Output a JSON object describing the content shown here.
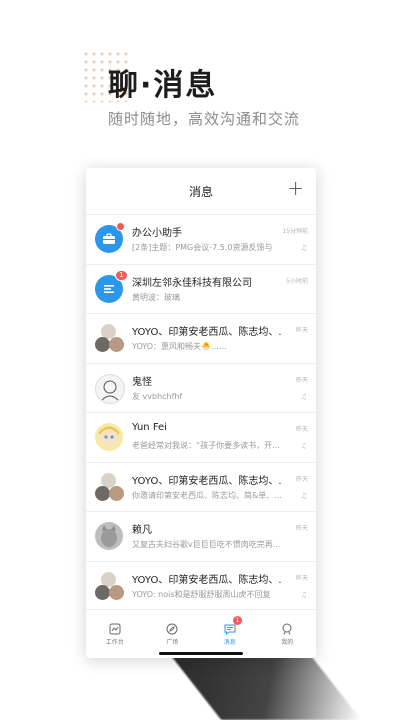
{
  "hero": {
    "title": "聊·消息",
    "subtitle": "随时随地，高效沟通和交流"
  },
  "header": {
    "title": "消息",
    "add_icon": "plus-icon"
  },
  "conversations": [
    {
      "name": "办公小助手",
      "preview": "[2条]主题：PMG会议-7.5.0资源反馈与",
      "time": "15分钟前",
      "badge": "",
      "muted": true
    },
    {
      "name": "深圳左邻永佳科技有限公司",
      "preview": "黄明波：玻璃",
      "time": "5小时前",
      "badge": "1",
      "muted": false
    },
    {
      "name": "YOYO、印第安老西瓜、陈志均、...",
      "preview": "YOYO：惠风和畅夫🐣……",
      "time": "昨天",
      "badge": "",
      "muted": false
    },
    {
      "name": "鬼怪",
      "preview": "友 vvbhchfhf",
      "time": "昨天",
      "badge": "",
      "muted": true
    },
    {
      "name": "Yun Fei",
      "preview": "老爸经常对我说：“孩子你要多读书，开...",
      "time": "昨天",
      "badge": "",
      "muted": true
    },
    {
      "name": "YOYO、印第安老西瓜、陈志均、...",
      "preview": "你邀请印第安老西瓜、陈志均、简&单、...",
      "time": "昨天",
      "badge": "",
      "muted": true
    },
    {
      "name": "赖凡",
      "preview": "又复古夫妇谷歌v巨巨巨吃不惯肉吃完再...",
      "time": "昨天",
      "badge": "",
      "muted": false
    },
    {
      "name": "YOYO、印第安老西瓜、陈志均、...",
      "preview": "YOYO: nois和是舒服舒服周山虎不回复",
      "time": "昨天",
      "badge": "",
      "muted": true
    }
  ],
  "tabs": [
    {
      "label": "工作台",
      "icon": "workbench-icon",
      "active": false,
      "badge": ""
    },
    {
      "label": "广场",
      "icon": "compass-icon",
      "active": false,
      "badge": ""
    },
    {
      "label": "消息",
      "icon": "message-icon",
      "active": true,
      "badge": "1"
    },
    {
      "label": "我的",
      "icon": "profile-icon",
      "active": false,
      "badge": ""
    }
  ],
  "colors": {
    "accent": "#2a97e8",
    "badge": "#f25a5a"
  }
}
